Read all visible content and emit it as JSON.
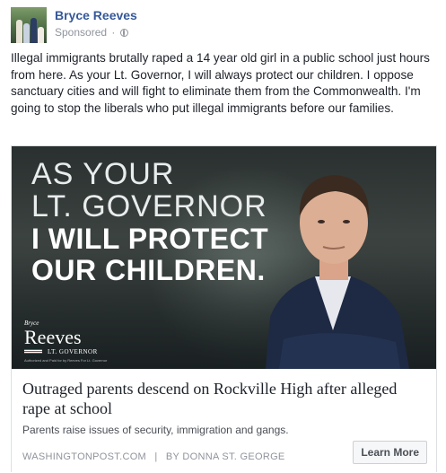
{
  "post": {
    "author": "Bryce Reeves",
    "sponsored": "Sponsored",
    "dot": "·",
    "more_icon": "more-options-icon",
    "text": "Illegal immigrants brutally raped a 14 year old girl in a public school just hours from here. As your Lt. Governor, I will always protect our children. I oppose sanctuary cities and will fight to eliminate them from the Commonwealth. I'm going to stop the liberals who put illegal immigrants before our families."
  },
  "ad": {
    "hero": {
      "line1": "AS YOUR",
      "line2": "LT. GOVERNOR",
      "line3": "I WILL PROTECT",
      "line4": "OUR CHILDREN.",
      "logo_small": "Bryce",
      "logo_name": "Reeves",
      "logo_role": "LT. GOVERNOR",
      "logo_fine": "Authorized and Paid for by Reeves For Lt. Governor"
    },
    "headline": "Outraged parents descend on Rockville High after alleged rape at school",
    "description": "Parents raise issues of security, immigration and gangs.",
    "source": "WASHINGTONPOST.COM",
    "separator": "|",
    "byline": "BY DONNA ST. GEORGE",
    "cta": "Learn More"
  },
  "colors": {
    "author_link": "#365899",
    "meta_gray": "#90949c",
    "text": "#1d2129",
    "border": "#dddfe2"
  }
}
